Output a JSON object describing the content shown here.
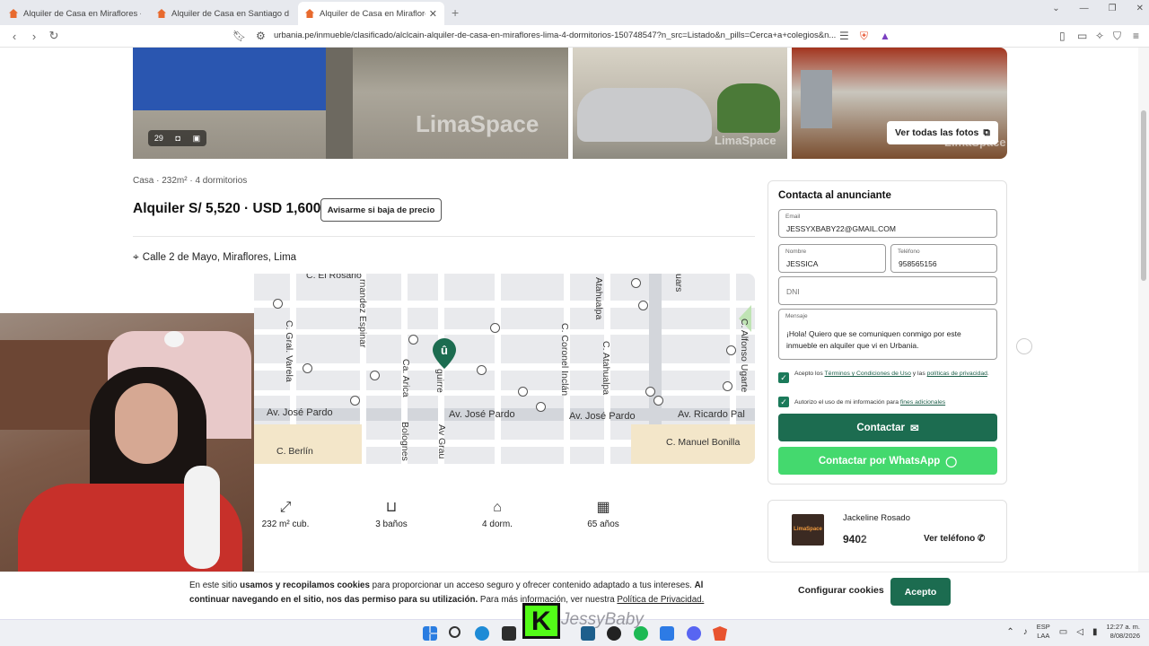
{
  "browser": {
    "tabs": [
      {
        "title": "Alquiler de Casa en Miraflores - Lima"
      },
      {
        "title": "Alquiler de Casa en Santiago de Surco"
      },
      {
        "title": "Alquiler de Casa en Miraflores - Li"
      }
    ],
    "url": "urbania.pe/inmueble/clasificado/alclcain-alquiler-de-casa-en-miraflores-lima-4-dormitorios-150748547?n_src=Listado&n_pills=Cerca+a+colegios&n..."
  },
  "gallery": {
    "photo_count": "29",
    "watermark": "LimaSpace",
    "see_all_label": "Ver todas las fotos"
  },
  "listing": {
    "specs": "Casa · 232m² · 4 dormitorios",
    "price": "Alquiler S/ 5,520 · USD 1,600",
    "price_alert_label": "Avisarme si baja de precio",
    "address": "Calle 2 de Mayo, Miraflores, Lima"
  },
  "map": {
    "streets": {
      "el_rosario": "C. El Rosario",
      "fernandez_espinar": "rnandez Espinar",
      "atahualpa_top": "Atahualpa",
      "quiars": "uars",
      "gral_varela": "C. Gral. Varela",
      "arica": "Ca. Arica",
      "aguirre": "guirre",
      "coronel_inclan": "C. Coronel Inclán",
      "atahualpa": "C. Atahualpa",
      "alfonso_ugarte": "C. Alfonso Ugarte",
      "jose_pardo_1": "Av. José Pardo",
      "jose_pardo_2": "Av. José Pardo",
      "jose_pardo_3": "Av. José Pardo",
      "ricardo_palma": "Av. Ricardo Pal",
      "bolognesi": "Bolognes",
      "grau": "Av Grau",
      "manuel_bonilla": "C. Manuel Bonilla",
      "berlin": "C. Berlín"
    }
  },
  "facts": [
    {
      "icon": "area-icon",
      "label": "232 m² cub."
    },
    {
      "icon": "toilet-icon",
      "label": "3 baños"
    },
    {
      "icon": "bed-icon",
      "label": "4 dorm."
    },
    {
      "icon": "calendar-icon",
      "label": "65 años"
    }
  ],
  "contact_form": {
    "title": "Contacta al anunciante",
    "email_label": "Email",
    "email_value": "JESSYXBABY22@GMAIL.COM",
    "name_label": "Nombre",
    "name_value": "JESSICA",
    "phone_label": "Teléfono",
    "phone_value": "958565156",
    "dni_placeholder": "DNI",
    "message_label": "Mensaje",
    "message_value": "¡Hola! Quiero que se comuniquen conmigo por este inmueble en alquiler que vi en Urbania.",
    "terms_prefix": "Acepto los ",
    "terms_link": "Términos y Condiciones de Uso",
    "terms_mid": " y las ",
    "privacy_link": "políticas de privacidad",
    "terms_suffix": ".",
    "auth_text": "Autorizo el uso de mi información para ",
    "auth_link": "fines adicionales",
    "contact_button": "Contactar",
    "whatsapp_button": "Contactar por WhatsApp"
  },
  "agent": {
    "logo_text": "LimaSpace",
    "name": "Jackeline Rosado",
    "phone_partial": "9402",
    "see_phone_label": "Ver teléfono"
  },
  "cookie_banner": {
    "t1": "En este sitio ",
    "t2": "usamos y recopilamos cookies",
    "t3": " para proporcionar un acceso seguro y ofrecer contenido adaptado a tus intereses. ",
    "t4": "Al continuar navegando en el sitio, nos das permiso para su utilización.",
    "t5": " Para más información, ver nuestra ",
    "link": "Política de Privacidad.",
    "config_label": "Configurar cookies",
    "accept_label": "Acepto"
  },
  "stream_overlay": {
    "badge": "K",
    "name": "JessyBaby"
  },
  "taskbar": {
    "lang1": "ESP",
    "lang2": "LAA",
    "time": "12:27 a. m.",
    "date": "8/08/2026"
  },
  "colors": {
    "brand_green": "#1c6c50",
    "whatsapp_green": "#44d96e"
  }
}
